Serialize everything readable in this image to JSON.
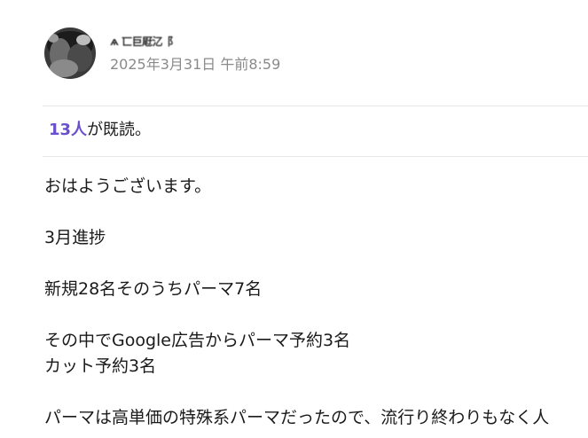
{
  "post": {
    "author_name": "ѧ 匸巨屘㲸⻏",
    "timestamp": "2025年3月31日 午前8:59"
  },
  "read_receipt": {
    "count": "13人",
    "suffix": "が既読。"
  },
  "message": {
    "lines": [
      "おはようございます。",
      "3月進捗",
      "新規28名そのうちパーマ7名",
      "その中でGoogle広告からパーマ予約3名",
      "カット予約3名",
      "パーマは高単価の特殊系パーマだったので、流行り終わりもなく人"
    ]
  },
  "colors": {
    "read_count": "#6a4fd0",
    "timestamp": "#8a8a8a",
    "divider": "#e6e6e6"
  }
}
